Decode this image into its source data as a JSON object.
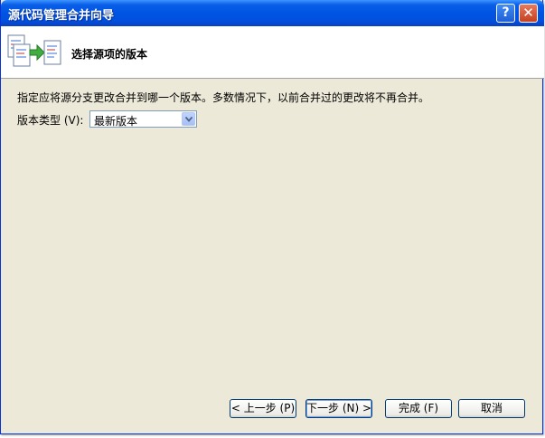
{
  "window": {
    "title": "源代码管理合并向导",
    "help_label": "?",
    "close_label": "✕"
  },
  "header": {
    "title": "选择源项的版本",
    "icon": "merge-wizard-icon"
  },
  "main": {
    "description": "指定应将源分支更改合并到哪一个版本。多数情况下，以前合并过的更改将不再合并。",
    "version_type_label": "版本类型 (V):",
    "version_type_selected": "最新版本"
  },
  "footer": {
    "back_label": "< 上一步 (P)",
    "next_label": "下一步 (N) >",
    "finish_label": "完成 (F)",
    "cancel_label": "取消"
  }
}
